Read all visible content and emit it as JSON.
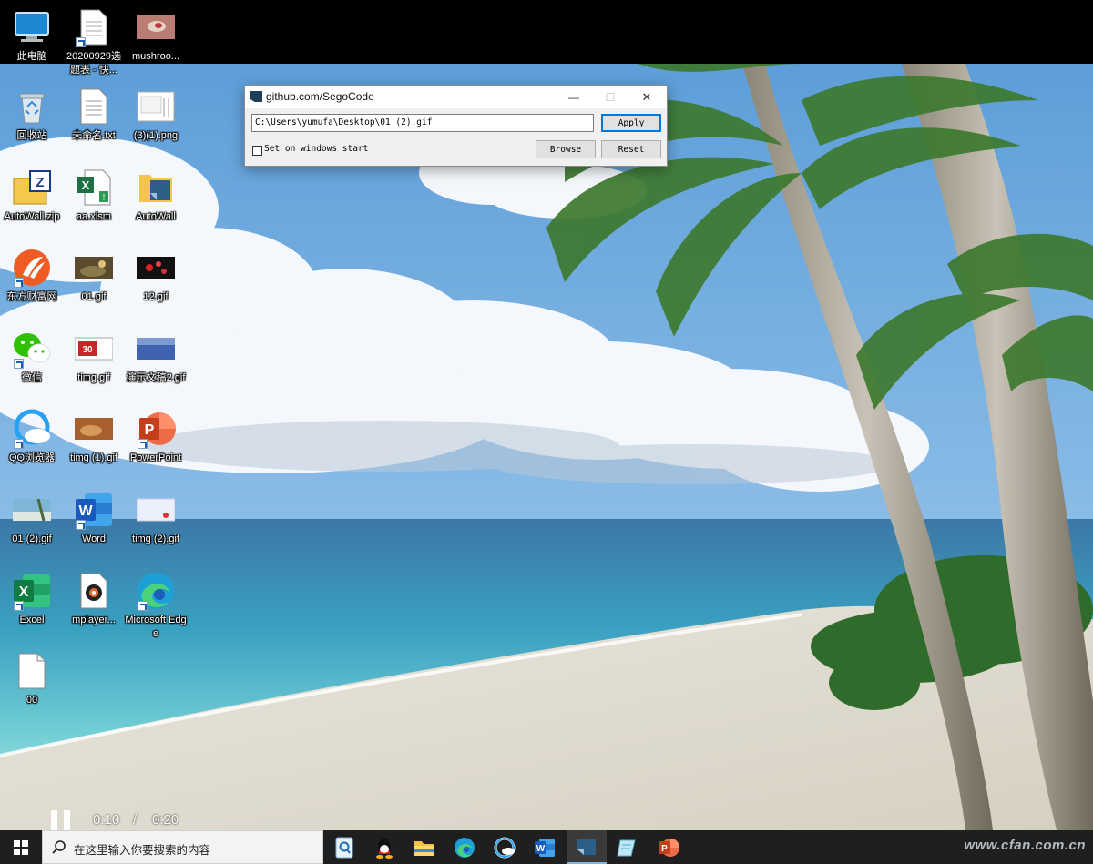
{
  "desktop": {
    "top_icons": [
      {
        "label": "此电脑",
        "icon": "computer-icon"
      },
      {
        "label": "20200929选题表 - 快...",
        "icon": "document-shortcut-icon"
      },
      {
        "label": "mushroo...",
        "icon": "image-file-icon"
      }
    ],
    "icons": [
      {
        "label": "回收站",
        "icon": "recycle-bin-icon"
      },
      {
        "label": "未命名.txt",
        "icon": "text-file-icon"
      },
      {
        "label": "(3)(1).png",
        "icon": "image-file-icon"
      },
      {
        "label": "AutoWall.zip",
        "icon": "zip-archive-icon"
      },
      {
        "label": "aa.xlsm",
        "icon": "excel-file-icon"
      },
      {
        "label": "AutoWall",
        "icon": "folder-icon"
      },
      {
        "label": "东方财富网",
        "icon": "eastmoney-app-icon"
      },
      {
        "label": "01.gif",
        "icon": "gif-file-icon"
      },
      {
        "label": "12.gif",
        "icon": "gif-file-icon"
      },
      {
        "label": "微信",
        "icon": "wechat-icon"
      },
      {
        "label": "timg.gif",
        "icon": "gif-file-icon"
      },
      {
        "label": "演示文稿2.gif",
        "icon": "gif-file-icon"
      },
      {
        "label": "QQ浏览器",
        "icon": "qq-browser-icon"
      },
      {
        "label": "timg (1).gif",
        "icon": "gif-file-icon"
      },
      {
        "label": "PowerPoint",
        "icon": "powerpoint-icon"
      },
      {
        "label": "01 (2).gif",
        "icon": "gif-file-icon"
      },
      {
        "label": "Word",
        "icon": "word-icon"
      },
      {
        "label": "timg (2).gif",
        "icon": "gif-file-icon"
      },
      {
        "label": "Excel",
        "icon": "excel-icon"
      },
      {
        "label": "mplayer...",
        "icon": "mplayer-icon"
      },
      {
        "label": "Microsoft Edge",
        "icon": "edge-icon"
      },
      {
        "label": "00",
        "icon": "blank-file-icon"
      }
    ]
  },
  "window": {
    "title": "github.com/SegoCode",
    "path_value": "C:\\Users\\yumufa\\Desktop\\01 (2).gif",
    "apply_label": "Apply",
    "browse_label": "Browse",
    "reset_label": "Reset",
    "startup_label": "Set on windows start",
    "startup_checked": false,
    "minimize_glyph": "—",
    "maximize_glyph": "☐",
    "close_glyph": "✕"
  },
  "video": {
    "current_time": "0:10",
    "separator": "/",
    "total_time": "0:20"
  },
  "taskbar": {
    "search_placeholder": "在这里输入你要搜索的内容",
    "apps": [
      "search-app-icon",
      "qq-icon",
      "file-explorer-icon",
      "edge-icon",
      "qq-browser-icon",
      "word-icon",
      "autowall-icon",
      "notepad-icon",
      "powerpoint-icon"
    ],
    "active_app": "autowall-icon",
    "watermark": "www.cfan.com.cn"
  }
}
